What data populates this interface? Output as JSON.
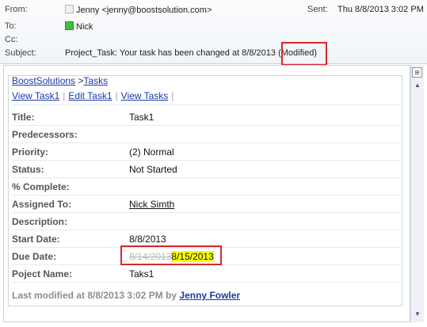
{
  "header": {
    "from_label": "From:",
    "from_value": "Jenny <jenny@boostsolution.com>",
    "to_label": "To:",
    "to_value": "Nick",
    "cc_label": "Cc:",
    "subject_label": "Subject:",
    "subject_value": "Project_Task: Your task has been changed at 8/8/2013",
    "subject_tag": "(Modified)",
    "sent_label": "Sent:",
    "sent_value": "Thu 8/8/2013 3:02 PM"
  },
  "breadcrumb": {
    "root": "BoostSolutions",
    "sep": ">",
    "current": "Tasks"
  },
  "actions": [
    "View Task1",
    "Edit Task1",
    "View Tasks"
  ],
  "fields": {
    "title": {
      "label": "Title:",
      "value": "Task1"
    },
    "predecessors": {
      "label": "Predecessors:",
      "value": ""
    },
    "priority": {
      "label": "Priority:",
      "value": "(2) Normal"
    },
    "status": {
      "label": "Status:",
      "value": "Not Started"
    },
    "complete": {
      "label": "% Complete:",
      "value": ""
    },
    "assigned": {
      "label": "Assigned To:",
      "value": "Nick Simth"
    },
    "description": {
      "label": "Description:",
      "value": ""
    },
    "start": {
      "label": "Start Date:",
      "value": "8/8/2013"
    },
    "due": {
      "label": "Due Date:",
      "old_value": "8/14/2013",
      "new_value": "8/15/2013"
    },
    "project": {
      "label": "Poject Name:",
      "value": "Taks1"
    }
  },
  "footer": {
    "text": "Last modified at 8/8/2013 3:02 PM by",
    "author": "Jenny Fowler"
  },
  "colors": {
    "accent_link": "#1a3aa8",
    "highlight": "#ffff00",
    "callout": "#d9262c"
  }
}
